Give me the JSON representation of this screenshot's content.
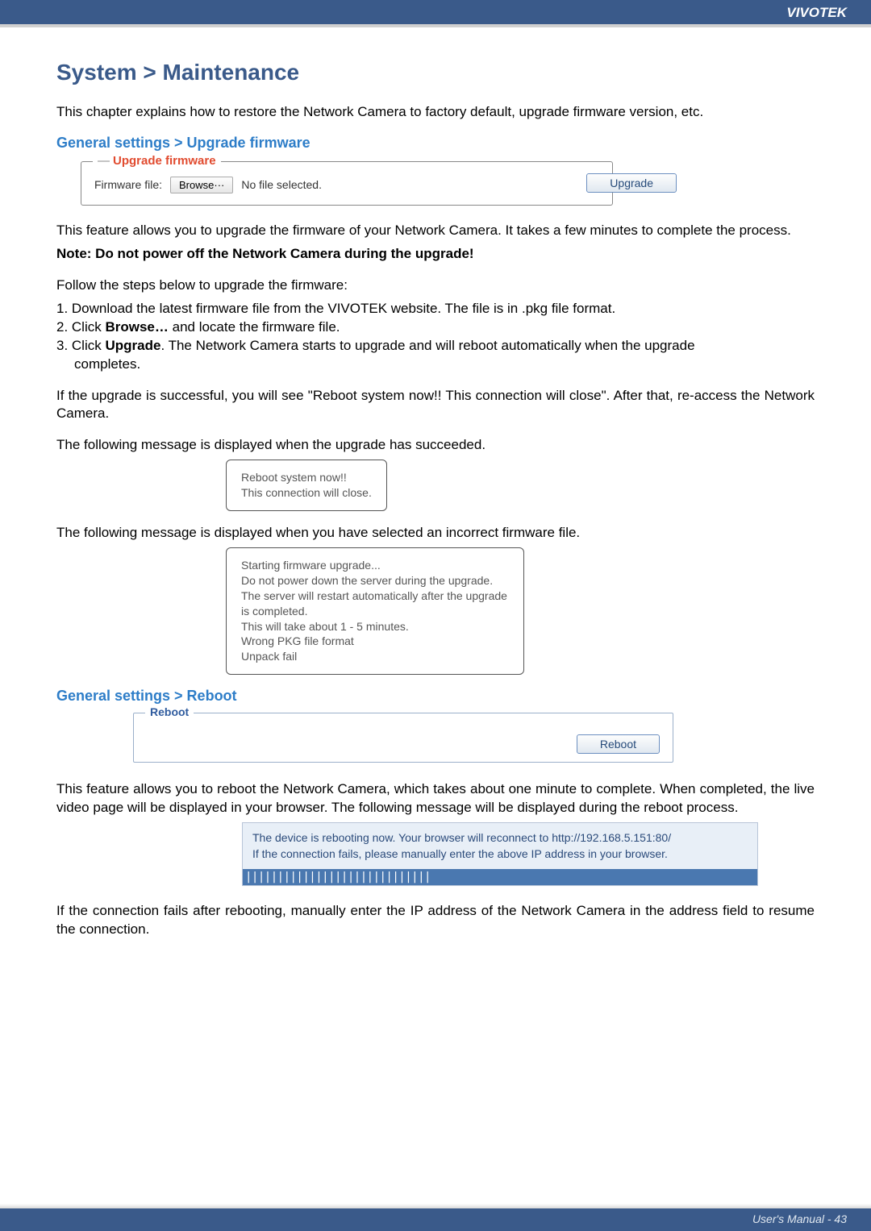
{
  "header": {
    "brand": "VIVOTEK"
  },
  "title": "System > Maintenance",
  "intro": "This chapter explains how to restore the Network Camera to factory default, upgrade firmware version, etc.",
  "upgrade_section": {
    "heading": "General settings > Upgrade firmware",
    "legend_dash": "—",
    "legend": "Upgrade firmware",
    "file_label": "Firmware file:",
    "browse_btn": "Browse···",
    "no_file": "No file selected.",
    "upgrade_btn": "Upgrade",
    "desc": "This feature allows you to upgrade the firmware of your Network Camera. It takes a few minutes to complete the process.",
    "note": "Note: Do not power off the Network Camera during the upgrade!",
    "follow": "Follow the steps below to upgrade the firmware:",
    "step1": "1. Download the latest firmware file from the VIVOTEK website. The file is in .pkg file format.",
    "step2a": "2. Click ",
    "step2b": "Browse…",
    "step2c": " and locate the firmware file.",
    "step3a": "3. Click ",
    "step3b": "Upgrade",
    "step3c": ". The Network Camera starts to upgrade and will reboot automatically when the upgrade",
    "step3d": "completes.",
    "success_para": "If the upgrade is successful, you will see \"Reboot system now!! This connection will close\". After that, re-access the Network Camera.",
    "msg_intro1": "The following message is displayed when the upgrade has succeeded.",
    "msg1_l1": "Reboot system now!!",
    "msg1_l2": "This connection will close.",
    "msg_intro2": "The following message is displayed when you have selected an incorrect firmware file.",
    "msg2_l1": "Starting firmware upgrade...",
    "msg2_l2": "Do not power down the server during the upgrade.",
    "msg2_l3": "The server will restart automatically after the upgrade is completed.",
    "msg2_l4": "This will take about 1 - 5 minutes.",
    "msg2_l5": "Wrong PKG file format",
    "msg2_l6": "Unpack fail"
  },
  "reboot_section": {
    "heading": "General settings > Reboot",
    "legend": "Reboot",
    "reboot_btn": "Reboot",
    "desc": "This feature allows you to reboot the Network Camera, which takes about one minute to complete. When completed, the live video page will be displayed in your browser. The following message will be displayed during the reboot process.",
    "msg_l1": "The device is rebooting now. Your browser will reconnect to http://192.168.5.151:80/",
    "msg_l2": "If the connection fails, please manually enter the above IP address in your browser.",
    "progress": "|||||||||||||||||||||||||||||",
    "after": "If the connection fails after rebooting, manually enter the IP address of the Network Camera in the address field to resume the connection."
  },
  "footer": {
    "text": "User's Manual - 43"
  }
}
